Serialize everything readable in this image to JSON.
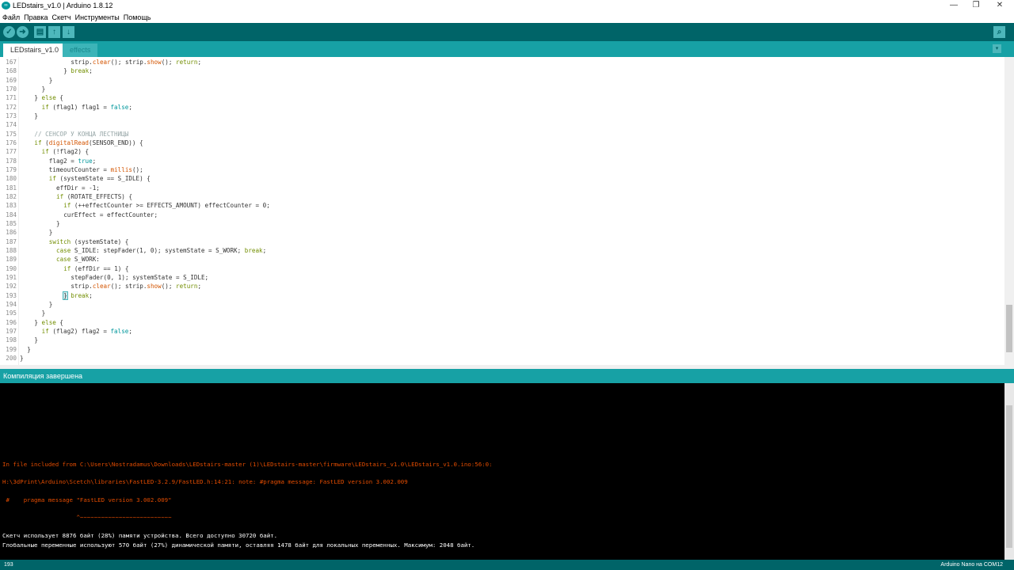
{
  "window": {
    "title": "LEDstairs_v1.0 | Arduino 1.8.12",
    "icon": "arduino-logo",
    "minimize": "—",
    "maximize": "❐",
    "close": "✕"
  },
  "menu": [
    "Файл",
    "Правка",
    "Скетч",
    "Инструменты",
    "Помощь"
  ],
  "toolbar": {
    "verify": "✓",
    "upload": "➜",
    "new": "▤",
    "open": "↑",
    "save": "↓",
    "serial_monitor": "⌕"
  },
  "tabs": [
    {
      "label": "LEDstairs_v1.0",
      "active": true
    },
    {
      "label": "effects",
      "active": false
    }
  ],
  "tab_menu": "▾",
  "editor": {
    "lines": [
      {
        "n": "167",
        "i": 14,
        "tk": [
          {
            "t": "strip."
          },
          {
            "t": "clear",
            "c": "fn"
          },
          {
            "t": "(); strip."
          },
          {
            "t": "show",
            "c": "fn"
          },
          {
            "t": "(); "
          },
          {
            "t": "return",
            "c": "kw"
          },
          {
            "t": ";"
          }
        ]
      },
      {
        "n": "168",
        "i": 12,
        "tk": [
          {
            "t": "} "
          },
          {
            "t": "break",
            "c": "kw"
          },
          {
            "t": ";"
          }
        ]
      },
      {
        "n": "169",
        "i": 8,
        "tk": [
          {
            "t": "}"
          }
        ]
      },
      {
        "n": "170",
        "i": 6,
        "tk": [
          {
            "t": "}"
          }
        ]
      },
      {
        "n": "171",
        "i": 4,
        "tk": [
          {
            "t": "} "
          },
          {
            "t": "else",
            "c": "kw"
          },
          {
            "t": " {"
          }
        ]
      },
      {
        "n": "172",
        "i": 6,
        "tk": [
          {
            "t": "if",
            "c": "kw"
          },
          {
            "t": " (flag1) flag1 = "
          },
          {
            "t": "false",
            "c": "lit"
          },
          {
            "t": ";"
          }
        ]
      },
      {
        "n": "173",
        "i": 4,
        "tk": [
          {
            "t": "}"
          }
        ]
      },
      {
        "n": "174",
        "i": 0,
        "tk": []
      },
      {
        "n": "175",
        "i": 4,
        "tk": [
          {
            "t": "// СЕНСОР У КОНЦА ЛЕСТНИЦЫ",
            "c": "cm"
          }
        ]
      },
      {
        "n": "176",
        "i": 4,
        "tk": [
          {
            "t": "if",
            "c": "kw"
          },
          {
            "t": " ("
          },
          {
            "t": "digitalRead",
            "c": "fn"
          },
          {
            "t": "(SENSOR_END)) {"
          }
        ]
      },
      {
        "n": "177",
        "i": 6,
        "tk": [
          {
            "t": "if",
            "c": "kw"
          },
          {
            "t": " (!flag2) {"
          }
        ]
      },
      {
        "n": "178",
        "i": 8,
        "tk": [
          {
            "t": "flag2 = "
          },
          {
            "t": "true",
            "c": "lit"
          },
          {
            "t": ";"
          }
        ]
      },
      {
        "n": "179",
        "i": 8,
        "tk": [
          {
            "t": "timeoutCounter = "
          },
          {
            "t": "millis",
            "c": "fn"
          },
          {
            "t": "();"
          }
        ]
      },
      {
        "n": "180",
        "i": 8,
        "tk": [
          {
            "t": "if",
            "c": "kw"
          },
          {
            "t": " (systemState == S_IDLE) {"
          }
        ]
      },
      {
        "n": "181",
        "i": 10,
        "tk": [
          {
            "t": "effDir = -1;"
          }
        ]
      },
      {
        "n": "182",
        "i": 10,
        "tk": [
          {
            "t": "if",
            "c": "kw"
          },
          {
            "t": " (ROTATE_EFFECTS) {"
          }
        ]
      },
      {
        "n": "183",
        "i": 12,
        "tk": [
          {
            "t": "if",
            "c": "kw"
          },
          {
            "t": " (++effectCounter >= EFFECTS_AMOUNT) effectCounter = 0;"
          }
        ]
      },
      {
        "n": "184",
        "i": 12,
        "tk": [
          {
            "t": "curEffect = effectCounter;"
          }
        ]
      },
      {
        "n": "185",
        "i": 10,
        "tk": [
          {
            "t": "}"
          }
        ]
      },
      {
        "n": "186",
        "i": 8,
        "tk": [
          {
            "t": "}"
          }
        ]
      },
      {
        "n": "187",
        "i": 8,
        "tk": [
          {
            "t": "switch",
            "c": "kw"
          },
          {
            "t": " (systemState) {"
          }
        ]
      },
      {
        "n": "188",
        "i": 10,
        "tk": [
          {
            "t": "case",
            "c": "kw"
          },
          {
            "t": " S_IDLE: stepFader(1, 0); systemState = S_WORK; "
          },
          {
            "t": "break",
            "c": "kw"
          },
          {
            "t": ";"
          }
        ]
      },
      {
        "n": "189",
        "i": 10,
        "tk": [
          {
            "t": "case",
            "c": "kw"
          },
          {
            "t": " S_WORK:"
          }
        ]
      },
      {
        "n": "190",
        "i": 12,
        "tk": [
          {
            "t": "if",
            "c": "kw"
          },
          {
            "t": " (effDir == 1) {"
          }
        ]
      },
      {
        "n": "191",
        "i": 14,
        "tk": [
          {
            "t": "stepFader(0, 1); systemState = S_IDLE;"
          }
        ]
      },
      {
        "n": "192",
        "i": 14,
        "tk": [
          {
            "t": "strip."
          },
          {
            "t": "clear",
            "c": "fn"
          },
          {
            "t": "(); strip."
          },
          {
            "t": "show",
            "c": "fn"
          },
          {
            "t": "(); "
          },
          {
            "t": "return",
            "c": "kw"
          },
          {
            "t": ";"
          }
        ]
      },
      {
        "n": "193",
        "i": 12,
        "tk": [
          {
            "t": "}",
            "c": "cur"
          },
          {
            "t": " "
          },
          {
            "t": "break",
            "c": "kw"
          },
          {
            "t": ";"
          }
        ]
      },
      {
        "n": "194",
        "i": 8,
        "tk": [
          {
            "t": "}"
          }
        ]
      },
      {
        "n": "195",
        "i": 6,
        "tk": [
          {
            "t": "}"
          }
        ]
      },
      {
        "n": "196",
        "i": 4,
        "tk": [
          {
            "t": "} "
          },
          {
            "t": "else",
            "c": "kw"
          },
          {
            "t": " {"
          }
        ]
      },
      {
        "n": "197",
        "i": 6,
        "tk": [
          {
            "t": "if",
            "c": "kw"
          },
          {
            "t": " (flag2) flag2 = "
          },
          {
            "t": "false",
            "c": "lit"
          },
          {
            "t": ";"
          }
        ]
      },
      {
        "n": "198",
        "i": 4,
        "tk": [
          {
            "t": "}"
          }
        ]
      },
      {
        "n": "199",
        "i": 2,
        "tk": [
          {
            "t": "}"
          }
        ]
      },
      {
        "n": "200",
        "i": 0,
        "tk": [
          {
            "t": "}"
          }
        ]
      }
    ]
  },
  "status_message": "Компиляция завершена",
  "console": [
    {
      "text": "In file included from C:\\Users\\Nostradamus\\Downloads\\LEDstairs-master (1)\\LEDstairs-master\\firmware\\LEDstairs_v1.0\\LEDstairs_v1.0.ino:56:0:",
      "kind": "err"
    },
    {
      "text": "H:\\3dPrint\\Arduino\\Scetch\\libraries\\FastLED-3.2.9/FastLED.h:14:21: note: #pragma message: FastLED version 3.002.009",
      "kind": "err"
    },
    {
      "text": " #    pragma message \"FastLED version 3.002.009\"",
      "kind": "err"
    },
    {
      "text": "                     ^~~~~~~~~~~~~~~~~~~~~~~~~~~",
      "kind": "err"
    },
    {
      "text": "Скетч использует 8876 байт (28%) памяти устройства. Всего доступно 30720 байт.",
      "kind": "ok"
    },
    {
      "text": "Глобальные переменные используют 570 байт (27%) динамической памяти, оставляя 1478 байт для локальных переменных. Максимум: 2048 байт.",
      "kind": "ok"
    }
  ],
  "statusbar": {
    "line": "193",
    "board": "Arduino Nano на COM12"
  },
  "colors": {
    "toolbar": "#006468",
    "tabbar": "#17a1a5",
    "keyword": "#728e00",
    "function": "#d35400",
    "literal": "#00979c",
    "error": "#e34c00"
  }
}
